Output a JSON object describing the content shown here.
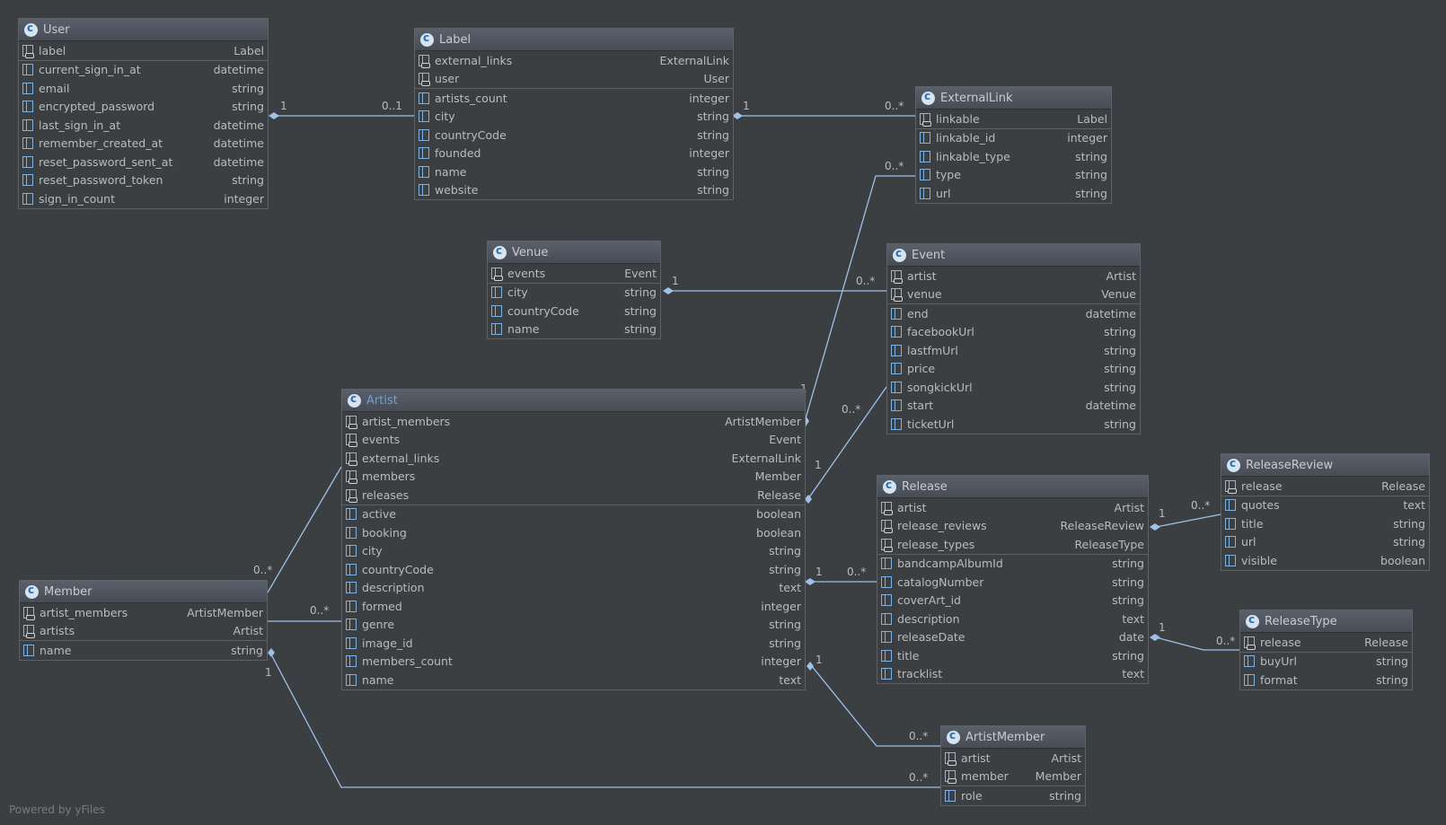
{
  "footer": "Powered by yFiles",
  "colors": {
    "background": "#3c3f41",
    "edge": "#9ec1ea",
    "header": "#515761"
  },
  "nodes": {
    "user": {
      "title": "User",
      "relations": [
        {
          "name": "label",
          "type": "Label"
        }
      ],
      "fields": [
        {
          "name": "current_sign_in_at",
          "type": "datetime"
        },
        {
          "name": "email",
          "type": "string"
        },
        {
          "name": "encrypted_password",
          "type": "string"
        },
        {
          "name": "last_sign_in_at",
          "type": "datetime"
        },
        {
          "name": "remember_created_at",
          "type": "datetime"
        },
        {
          "name": "reset_password_sent_at",
          "type": "datetime"
        },
        {
          "name": "reset_password_token",
          "type": "string"
        },
        {
          "name": "sign_in_count",
          "type": "integer"
        }
      ]
    },
    "label": {
      "title": "Label",
      "relations": [
        {
          "name": "external_links",
          "type": "ExternalLink"
        },
        {
          "name": "user",
          "type": "User"
        }
      ],
      "fields": [
        {
          "name": "artists_count",
          "type": "integer"
        },
        {
          "name": "city",
          "type": "string"
        },
        {
          "name": "countryCode",
          "type": "string"
        },
        {
          "name": "founded",
          "type": "integer"
        },
        {
          "name": "name",
          "type": "string"
        },
        {
          "name": "website",
          "type": "string"
        }
      ]
    },
    "externallink": {
      "title": "ExternalLink",
      "relations": [
        {
          "name": "linkable",
          "type": "Label"
        }
      ],
      "fields": [
        {
          "name": "linkable_id",
          "type": "integer"
        },
        {
          "name": "linkable_type",
          "type": "string"
        },
        {
          "name": "type",
          "type": "string"
        },
        {
          "name": "url",
          "type": "string"
        }
      ]
    },
    "venue": {
      "title": "Venue",
      "relations": [
        {
          "name": "events",
          "type": "Event"
        }
      ],
      "fields": [
        {
          "name": "city",
          "type": "string"
        },
        {
          "name": "countryCode",
          "type": "string"
        },
        {
          "name": "name",
          "type": "string"
        }
      ]
    },
    "event": {
      "title": "Event",
      "relations": [
        {
          "name": "artist",
          "type": "Artist"
        },
        {
          "name": "venue",
          "type": "Venue"
        }
      ],
      "fields": [
        {
          "name": "end",
          "type": "datetime"
        },
        {
          "name": "facebookUrl",
          "type": "string"
        },
        {
          "name": "lastfmUrl",
          "type": "string"
        },
        {
          "name": "price",
          "type": "string"
        },
        {
          "name": "songkickUrl",
          "type": "string"
        },
        {
          "name": "start",
          "type": "datetime"
        },
        {
          "name": "ticketUrl",
          "type": "string"
        }
      ]
    },
    "artist": {
      "title": "Artist",
      "relations": [
        {
          "name": "artist_members",
          "type": "ArtistMember"
        },
        {
          "name": "events",
          "type": "Event"
        },
        {
          "name": "external_links",
          "type": "ExternalLink"
        },
        {
          "name": "members",
          "type": "Member"
        },
        {
          "name": "releases",
          "type": "Release"
        }
      ],
      "fields": [
        {
          "name": "active",
          "type": "boolean"
        },
        {
          "name": "booking",
          "type": "boolean"
        },
        {
          "name": "city",
          "type": "string"
        },
        {
          "name": "countryCode",
          "type": "string"
        },
        {
          "name": "description",
          "type": "text"
        },
        {
          "name": "formed",
          "type": "integer"
        },
        {
          "name": "genre",
          "type": "string"
        },
        {
          "name": "image_id",
          "type": "string"
        },
        {
          "name": "members_count",
          "type": "integer"
        },
        {
          "name": "name",
          "type": "text"
        }
      ]
    },
    "member": {
      "title": "Member",
      "relations": [
        {
          "name": "artist_members",
          "type": "ArtistMember"
        },
        {
          "name": "artists",
          "type": "Artist"
        }
      ],
      "fields": [
        {
          "name": "name",
          "type": "string"
        }
      ]
    },
    "release": {
      "title": "Release",
      "relations": [
        {
          "name": "artist",
          "type": "Artist"
        },
        {
          "name": "release_reviews",
          "type": "ReleaseReview"
        },
        {
          "name": "release_types",
          "type": "ReleaseType"
        }
      ],
      "fields": [
        {
          "name": "bandcampAlbumId",
          "type": "string"
        },
        {
          "name": "catalogNumber",
          "type": "string"
        },
        {
          "name": "coverArt_id",
          "type": "string"
        },
        {
          "name": "description",
          "type": "text"
        },
        {
          "name": "releaseDate",
          "type": "date"
        },
        {
          "name": "title",
          "type": "string"
        },
        {
          "name": "tracklist",
          "type": "text"
        }
      ]
    },
    "releasereview": {
      "title": "ReleaseReview",
      "relations": [
        {
          "name": "release",
          "type": "Release"
        }
      ],
      "fields": [
        {
          "name": "quotes",
          "type": "text"
        },
        {
          "name": "title",
          "type": "string"
        },
        {
          "name": "url",
          "type": "string"
        },
        {
          "name": "visible",
          "type": "boolean"
        }
      ]
    },
    "releasetype": {
      "title": "ReleaseType",
      "relations": [
        {
          "name": "release",
          "type": "Release"
        }
      ],
      "fields": [
        {
          "name": "buyUrl",
          "type": "string"
        },
        {
          "name": "format",
          "type": "string"
        }
      ]
    },
    "artistmember": {
      "title": "ArtistMember",
      "relations": [
        {
          "name": "artist",
          "type": "Artist"
        },
        {
          "name": "member",
          "type": "Member"
        }
      ],
      "fields": [
        {
          "name": "role",
          "type": "string"
        }
      ]
    }
  },
  "edges": [
    {
      "id": "user-label",
      "from_mult": "1",
      "to_mult": "0..1"
    },
    {
      "id": "label-externallink",
      "from_mult": "1",
      "to_mult": "0..*"
    },
    {
      "id": "artist-externallink",
      "from_mult": "1",
      "to_mult": "0..*"
    },
    {
      "id": "venue-event",
      "from_mult": "1",
      "to_mult": "0..*"
    },
    {
      "id": "artist-event",
      "from_mult": "1",
      "to_mult": "0..*"
    },
    {
      "id": "artist-release",
      "from_mult": "1",
      "to_mult": "0..*"
    },
    {
      "id": "release-releasereview",
      "from_mult": "1",
      "to_mult": "0..*"
    },
    {
      "id": "release-releasetype",
      "from_mult": "1",
      "to_mult": "0..*"
    },
    {
      "id": "artist-artistmember",
      "from_mult": "1",
      "to_mult": "0..*"
    },
    {
      "id": "member-artistmember",
      "from_mult": "1",
      "to_mult": "0..*"
    },
    {
      "id": "member-artist",
      "from_mult": "0..*",
      "to_mult": "0..*"
    }
  ]
}
